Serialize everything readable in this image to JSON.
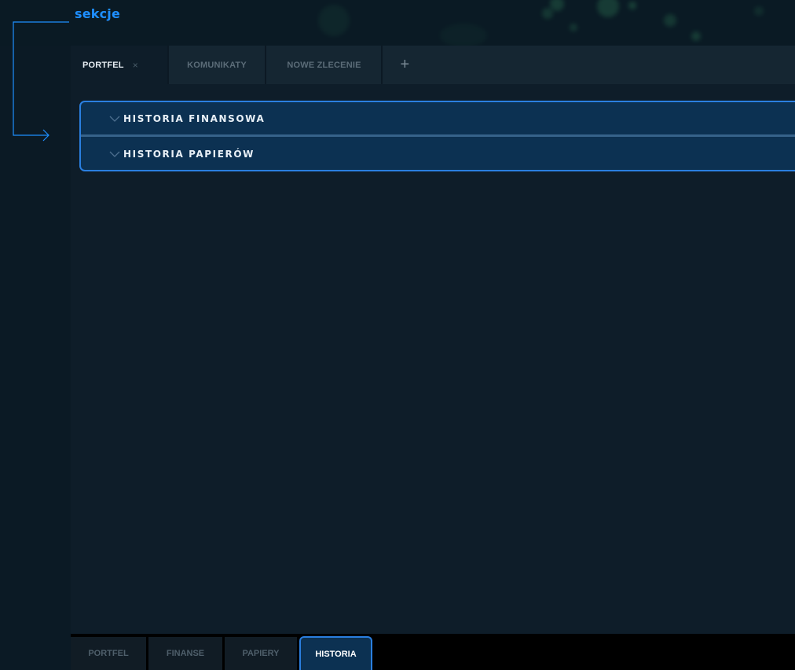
{
  "annotation": {
    "label": "sekcje",
    "color": "#1e8fff"
  },
  "top_tabs": {
    "items": [
      {
        "label": "PORTFEL",
        "active": true,
        "closable": true,
        "close_glyph": "×"
      },
      {
        "label": "KOMUNIKATY",
        "active": false
      },
      {
        "label": "NOWE ZLECENIE",
        "active": false
      }
    ],
    "add_icon": "+"
  },
  "sections": {
    "items": [
      {
        "label": "HISTORIA FINANSOWA",
        "icon": "chevron-down-icon"
      },
      {
        "label": "HISTORIA PAPIERÓW",
        "icon": "chevron-down-icon"
      }
    ],
    "accent": "#2a7fe0"
  },
  "bottom_tabs": {
    "items": [
      {
        "label": "PORTFEL",
        "active": false
      },
      {
        "label": "FINANSE",
        "active": false
      },
      {
        "label": "PAPIERY",
        "active": false
      },
      {
        "label": "HISTORIA",
        "active": true
      }
    ]
  },
  "colors": {
    "background": "#0b1a25",
    "panel": "#0e1d29",
    "section_bg": "#0c3152",
    "accent_blue": "#2a7fe0"
  }
}
